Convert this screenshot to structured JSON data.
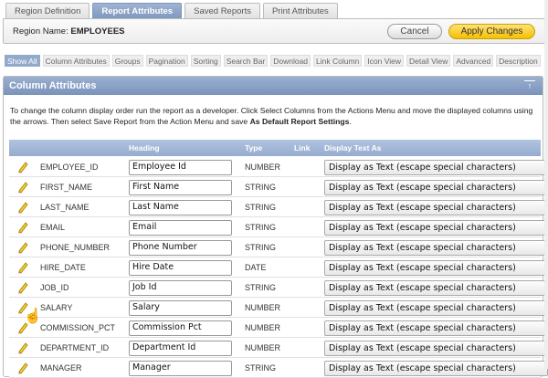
{
  "tabs": [
    {
      "label": "Region Definition"
    },
    {
      "label": "Report Attributes",
      "active": true
    },
    {
      "label": "Saved Reports"
    },
    {
      "label": "Print Attributes"
    }
  ],
  "region": {
    "label": "Region Name:",
    "value": "EMPLOYEES",
    "cancel": "Cancel",
    "apply": "Apply Changes"
  },
  "subtabs": [
    "Show All",
    "Column Attributes",
    "Groups",
    "Pagination",
    "Sorting",
    "Search Bar",
    "Download",
    "Link Column",
    "Icon View",
    "Detail View",
    "Advanced",
    "Description"
  ],
  "panel": {
    "title": "Column Attributes",
    "desc1": "To change the column display order run the report as a developer. Click Select Columns from the Actions Menu and move the displayed columns using the arrows. Then select Save Report from the Action Menu and save ",
    "desc_bold": "As Default Report Settings",
    "desc2": "."
  },
  "table": {
    "headers": {
      "heading": "Heading",
      "type": "Type",
      "link": "Link",
      "display": "Display Text As"
    },
    "rows": [
      {
        "name": "EMPLOYEE_ID",
        "heading": "Employee Id",
        "type": "NUMBER",
        "display": "Display as Text (escape special characters)"
      },
      {
        "name": "FIRST_NAME",
        "heading": "First Name",
        "type": "STRING",
        "display": "Display as Text (escape special characters)"
      },
      {
        "name": "LAST_NAME",
        "heading": "Last Name",
        "type": "STRING",
        "display": "Display as Text (escape special characters)"
      },
      {
        "name": "EMAIL",
        "heading": "Email",
        "type": "STRING",
        "display": "Display as Text (escape special characters)"
      },
      {
        "name": "PHONE_NUMBER",
        "heading": "Phone Number",
        "type": "STRING",
        "display": "Display as Text (escape special characters)"
      },
      {
        "name": "HIRE_DATE",
        "heading": "Hire Date",
        "type": "DATE",
        "display": "Display as Text (escape special characters)"
      },
      {
        "name": "JOB_ID",
        "heading": "Job Id",
        "type": "STRING",
        "display": "Display as Text (escape special characters)"
      },
      {
        "name": "SALARY",
        "heading": "Salary",
        "type": "NUMBER",
        "display": "Display as Text (escape special characters)"
      },
      {
        "name": "COMMISSION_PCT",
        "heading": "Commission Pct",
        "type": "NUMBER",
        "display": "Display as Text (escape special characters)"
      },
      {
        "name": "DEPARTMENT_ID",
        "heading": "Department Id",
        "type": "NUMBER",
        "display": "Display as Text (escape special characters)"
      },
      {
        "name": "MANAGER",
        "heading": "Manager",
        "type": "STRING",
        "display": "Display as Text (escape special characters)"
      }
    ]
  }
}
